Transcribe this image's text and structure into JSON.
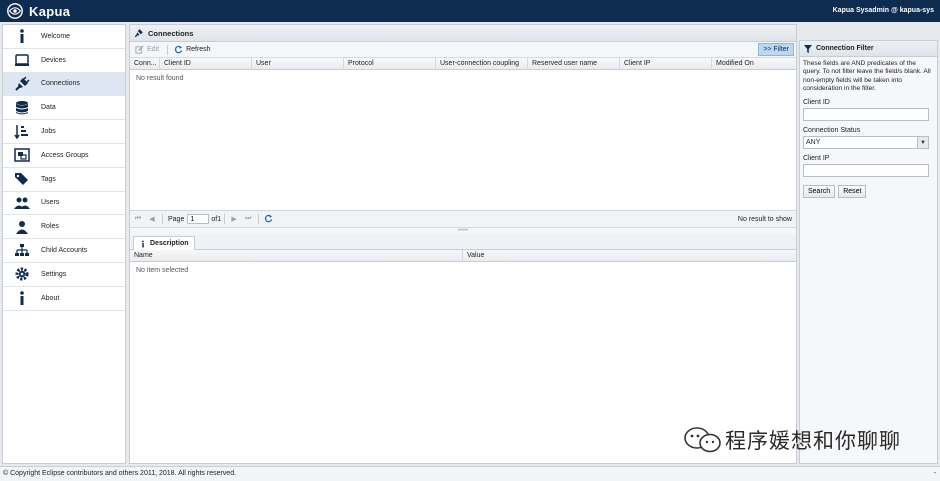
{
  "header": {
    "app_name": "Kapua",
    "user": "Kapua Sysadmin @ kapua-sys"
  },
  "sidebar": {
    "items": [
      {
        "label": "Welcome",
        "icon": "info-icon"
      },
      {
        "label": "Devices",
        "icon": "device-icon"
      },
      {
        "label": "Connections",
        "icon": "plug-icon",
        "active": true
      },
      {
        "label": "Data",
        "icon": "database-icon"
      },
      {
        "label": "Jobs",
        "icon": "jobs-icon"
      },
      {
        "label": "Access Groups",
        "icon": "groups-icon"
      },
      {
        "label": "Tags",
        "icon": "tags-icon"
      },
      {
        "label": "Users",
        "icon": "users-icon"
      },
      {
        "label": "Roles",
        "icon": "roles-icon"
      },
      {
        "label": "Child Accounts",
        "icon": "sitemap-icon"
      },
      {
        "label": "Settings",
        "icon": "gear-icon"
      },
      {
        "label": "About",
        "icon": "info-icon"
      }
    ]
  },
  "main": {
    "title": "Connections",
    "toolbar": {
      "edit_label": "Edit",
      "refresh_label": "Refresh",
      "filter_label": ">> Filter"
    },
    "columns": [
      "Conn...",
      "Client ID",
      "User",
      "Protocol",
      "User-connection coupling",
      "Reserved user name",
      "Client IP",
      "Modified On"
    ],
    "empty_text": "No result found",
    "pager": {
      "page_label": "Page",
      "page_value": "1",
      "of_label": "of1",
      "status": "No result to show"
    },
    "description": {
      "tab_label": "Description",
      "columns": [
        "Name",
        "Value"
      ],
      "empty_text": "No item selected"
    }
  },
  "filter_panel": {
    "title": "Connection Filter",
    "note": "These fields are AND predicates of the query. To not filter leave the field/s blank. All non-empty fields will be taken into consideration in the filter.",
    "client_id_label": "Client ID",
    "client_id_value": "",
    "status_label": "Connection Status",
    "status_value": "ANY",
    "client_ip_label": "Client IP",
    "client_ip_value": "",
    "search_label": "Search",
    "reset_label": "Reset"
  },
  "footer": {
    "copyright": "© Copyright Eclipse contributors and others 2011, 2018.  All rights reserved.",
    "marker": "-"
  },
  "watermark": {
    "text": "程序媛想和你聊聊"
  },
  "colors": {
    "topbar": "#0e2c4f",
    "active_nav": "#dde6f2",
    "filter_button": "#bcd8f3"
  }
}
